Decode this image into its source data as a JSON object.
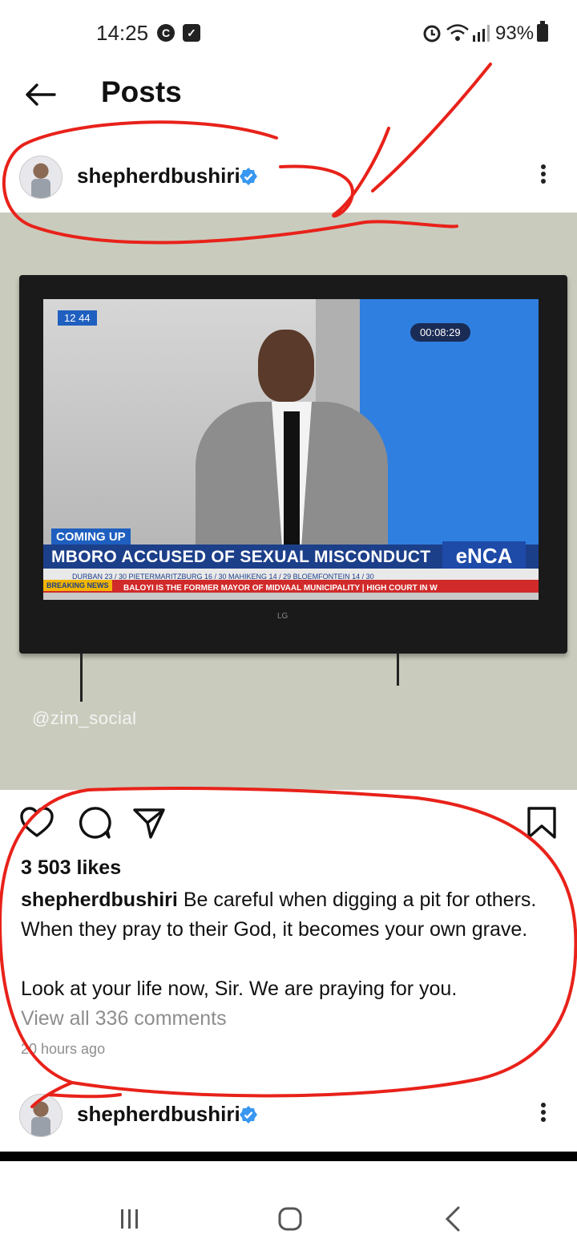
{
  "status_bar": {
    "time": "14:25",
    "battery": "93%"
  },
  "header": {
    "title": "Posts"
  },
  "post": {
    "username": "shepherdbushiri",
    "image": {
      "tv_clock": "12 44",
      "tv_timer": "00:08:29",
      "coming_up": "COMING UP",
      "headline": "MBORO ACCUSED OF SEXUAL MISCONDUCT",
      "channel": "eNCA",
      "ticker_weather": "DURBAN 23 / 30    PIETERMARITZBURG 16 / 30    MAHIKENG 14 / 29    BLOEMFONTEIN 14 / 30",
      "breaking": "BREAKING NEWS",
      "ticker_news": "BALOYI IS THE FORMER MAYOR OF MIDVAAL MUNICIPALITY  |  HIGH COURT IN W",
      "tv_brand": "LG",
      "watermark": "@zim_social"
    },
    "likes": "3 503 likes",
    "caption_user": "shepherdbushiri",
    "caption_line1": " Be careful when digging a pit for others. When they pray to their God, it becomes your own grave.",
    "caption_line2": "Look at your life now, Sir. We are praying for you.",
    "view_comments": "View all 336 comments",
    "time_ago": "20 hours ago"
  },
  "next_post": {
    "username": "shepherdbushiri"
  },
  "colors": {
    "verified": "#3897f0",
    "annotation": "#e8221a",
    "muted": "#8e8e8e"
  }
}
